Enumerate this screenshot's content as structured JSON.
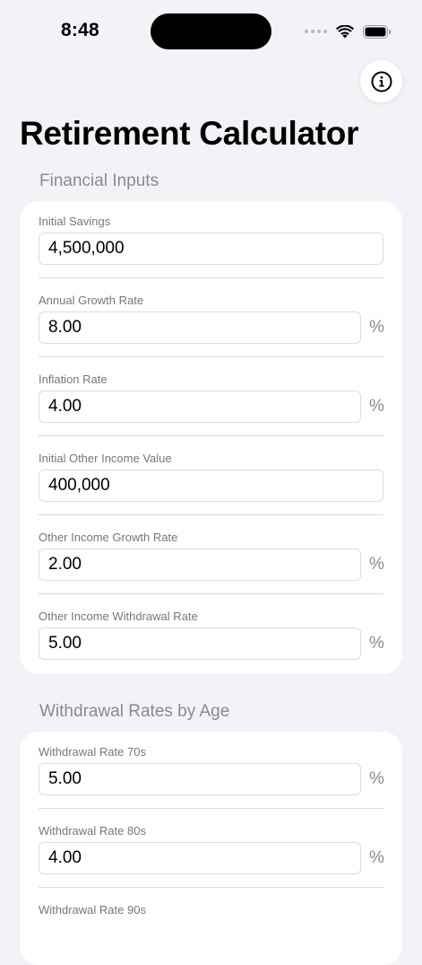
{
  "status_bar": {
    "time": "8:48"
  },
  "info_button": {
    "icon": "info-icon"
  },
  "page": {
    "title": "Retirement Calculator"
  },
  "financial_inputs": {
    "header": "Financial Inputs",
    "fields": [
      {
        "label": "Initial Savings",
        "value": "4,500,000",
        "unit": ""
      },
      {
        "label": "Annual Growth Rate",
        "value": "8.00",
        "unit": "%"
      },
      {
        "label": "Inflation Rate",
        "value": "4.00",
        "unit": "%"
      },
      {
        "label": "Initial Other Income Value",
        "value": "400,000",
        "unit": ""
      },
      {
        "label": "Other Income Growth Rate",
        "value": "2.00",
        "unit": "%"
      },
      {
        "label": "Other Income Withdrawal Rate",
        "value": "5.00",
        "unit": "%"
      }
    ]
  },
  "withdrawal_rates": {
    "header": "Withdrawal Rates by Age",
    "fields": [
      {
        "label": "Withdrawal Rate 70s",
        "value": "5.00",
        "unit": "%"
      },
      {
        "label": "Withdrawal Rate 80s",
        "value": "4.00",
        "unit": "%"
      },
      {
        "label": "Withdrawal Rate 90s",
        "value": "",
        "unit": ""
      }
    ]
  }
}
